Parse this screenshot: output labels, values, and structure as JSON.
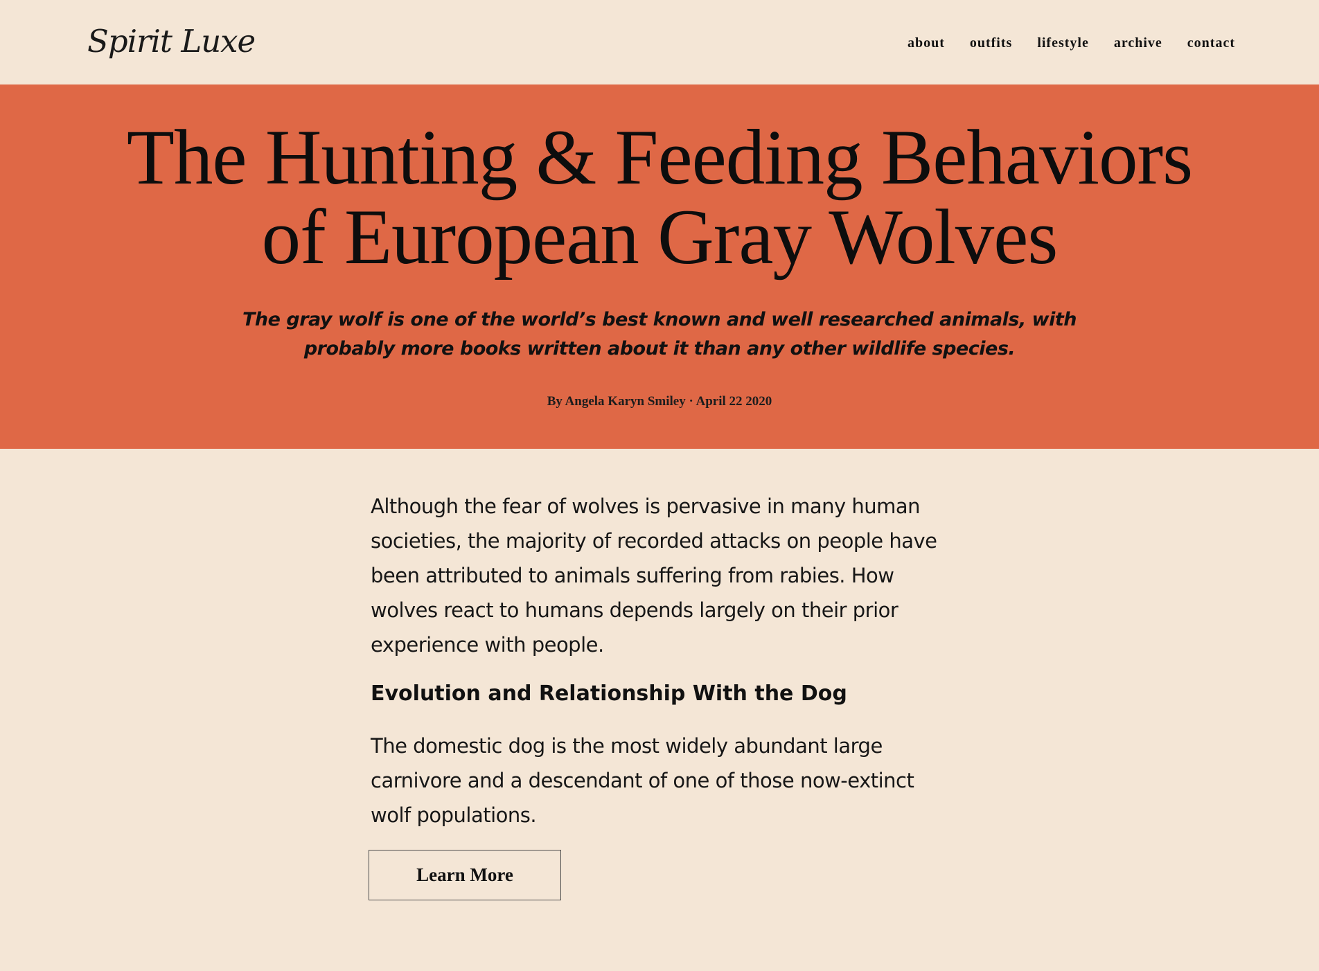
{
  "site": {
    "logo": "Spirit Luxe"
  },
  "nav": {
    "items": [
      {
        "label": "about"
      },
      {
        "label": "outfits"
      },
      {
        "label": "lifestyle"
      },
      {
        "label": "archive"
      },
      {
        "label": "contact"
      }
    ]
  },
  "hero": {
    "title": "The Hunting & Feeding Behaviors of European Gray Wolves",
    "subtitle": "The gray wolf is one of the world’s best known and well researched animals, with probably more books written about it than any other wildlife species.",
    "byline": "By Angela Karyn Smiley · April 22 2020"
  },
  "article": {
    "paragraph_1": "Although the fear of wolves is pervasive in many human societies, the majority of recorded attacks on people have been attributed to animals suffering from rabies. How wolves react to humans depends largely on their prior experience with people.",
    "heading": "Evolution and Relationship With the Dog",
    "paragraph_2": "The domestic dog is the most widely abundant large carnivore and a descendant of one of those now-extinct wolf populations.",
    "button_label": "Learn More"
  },
  "colors": {
    "page_background": "#f4e6d6",
    "hero_background": "#df6846",
    "text": "#111111",
    "button_border": "#4a4a4a"
  }
}
